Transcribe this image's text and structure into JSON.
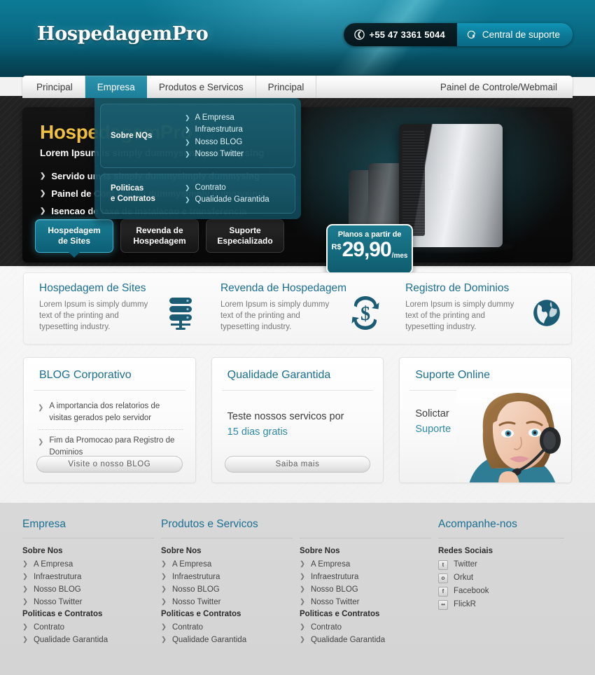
{
  "header": {
    "logo": "HospedagemPro",
    "phone": "+55 47 3361 5044",
    "support": "Central de suporte",
    "phone_icon": "phone-icon",
    "headset_icon": "headset-icon"
  },
  "nav": {
    "items": [
      {
        "label": "Principal",
        "active": false
      },
      {
        "label": "Empresa",
        "active": true
      },
      {
        "label": "Produtos e Servicos",
        "active": false
      },
      {
        "label": "Principal",
        "active": false
      }
    ],
    "right_item": "Painel de Controle/Webmail"
  },
  "dropdown": {
    "groups": [
      {
        "title": "Sobre NQs",
        "links": [
          "A Empresa",
          "Infraestrutura",
          "Nosso BLOG",
          "Nosso Twitter"
        ]
      },
      {
        "title": "Politicas e Contratos",
        "title_line1": "Politicas",
        "title_line2": "e Contratos",
        "links": [
          "Contrato",
          "Qualidade Garantida"
        ]
      }
    ]
  },
  "hero": {
    "title": "HospedagemPro",
    "subtitle": "Lorem Ipsum is simply dummysimply dummysing",
    "bullets": [
      "Servido um is simply dummysimply dummysing",
      "Painel de Cont simply dummysimply dummysing",
      "Isencao de taxa de instalacao e transferencia"
    ]
  },
  "tabs": [
    {
      "line1": "Hospedagem",
      "line2": "de Sites",
      "active": true
    },
    {
      "line1": "Revenda de",
      "line2": "Hospedagem",
      "active": false
    },
    {
      "line1": "Suporte",
      "line2": "Especializado",
      "active": false
    }
  ],
  "price": {
    "label": "Planos a partir de",
    "currency": "R$",
    "value": "29,90",
    "period": "/mes"
  },
  "services": [
    {
      "title": "Hospedagem de Sites",
      "desc": "Lorem Ipsum is simply dummy text of the printing and typesetting industry.",
      "icon": "server-stack-icon"
    },
    {
      "title": "Revenda de Hospedagem",
      "desc": "Lorem Ipsum is simply dummy text of the printing and typesetting industry.",
      "icon": "dollar-refresh-icon"
    },
    {
      "title": "Registro de Dominios",
      "desc": "Lorem Ipsum is simply dummy text of the printing and typesetting industry.",
      "icon": "globe-icon"
    }
  ],
  "blog_box": {
    "title": "BLOG Corporativo",
    "items": [
      "A importancia dos relatorios de visitas gerados pelo servidor",
      "Fim da Promocao para Registro de Dominios"
    ],
    "button": "Visite o nosso BLOG"
  },
  "quality_box": {
    "title": "Qualidade Garantida",
    "line1": "Teste nossos servicos por",
    "line2": "15 dias gratis",
    "button": "Saiba mais"
  },
  "support_box": {
    "title": "Suporte Online",
    "line1": "Solictar",
    "line2": "Suporte"
  },
  "footer": {
    "columns": [
      {
        "head": "Empresa",
        "groups": [
          {
            "title": "Sobre Nos",
            "links": [
              "A Empresa",
              "Infraestrutura",
              "Nosso BLOG",
              "Nosso Twitter"
            ]
          },
          {
            "title": "Politicas e Contratos",
            "links": [
              "Contrato",
              "Qualidade Garantida"
            ]
          }
        ]
      },
      {
        "head": "Produtos e Servicos",
        "groups": [
          {
            "title": "Sobre Nos",
            "links": [
              "A Empresa",
              "Infraestrutura",
              "Nosso BLOG",
              "Nosso Twitter"
            ]
          },
          {
            "title": "Politicas e Contratos",
            "links": [
              "Contrato",
              "Qualidade Garantida"
            ]
          }
        ]
      },
      {
        "head": "",
        "groups": [
          {
            "title": "Sobre Nos",
            "links": [
              "A Empresa",
              "Infraestrutura",
              "Nosso BLOG",
              "Nosso Twitter"
            ]
          },
          {
            "title": "Politicas e Contratos",
            "links": [
              "Contrato",
              "Qualidade Garantida"
            ]
          }
        ]
      }
    ],
    "social_column": {
      "head": "Acompanhe-nos",
      "title": "Redes Sociais",
      "items": [
        {
          "label": "Twitter",
          "icon": "twitter-icon",
          "glyph": "t"
        },
        {
          "label": "Orkut",
          "icon": "orkut-icon",
          "glyph": "o"
        },
        {
          "label": "Facebook",
          "icon": "facebook-icon",
          "glyph": "f"
        },
        {
          "label": "FlickR",
          "icon": "flickr-icon",
          "glyph": "••"
        }
      ]
    }
  },
  "colors": {
    "teal": "#1b6f91",
    "header_teal": "#0a6d88",
    "gold": "#f0c040",
    "accent": "#2e8aa8"
  }
}
